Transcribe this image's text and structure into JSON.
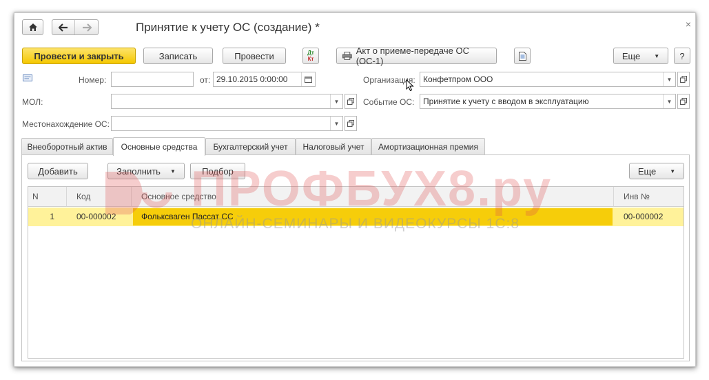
{
  "window": {
    "title": "Принятие к учету ОС (создание) *",
    "close": "×"
  },
  "toolbar": {
    "post_close": "Провести и закрыть",
    "save": "Записать",
    "post": "Провести",
    "dt_kt_top": "Дт",
    "dt_kt_bottom": "Кт",
    "print_act": "Акт о приеме-передаче ОС (ОС-1)",
    "more": "Еще",
    "help": "?"
  },
  "form": {
    "number_label": "Номер:",
    "number_value": "",
    "date_label": "от:",
    "date_value": "29.10.2015  0:00:00",
    "org_label": "Организация:",
    "org_value": "Конфетпром ООО",
    "mol_label": "МОЛ:",
    "mol_value": "",
    "event_label": "Событие ОС:",
    "event_value": "Принятие к учету с вводом в эксплуатацию",
    "location_label": "Местонахождение ОС:",
    "location_value": ""
  },
  "tabs": [
    {
      "label": "Внеоборотный актив"
    },
    {
      "label": "Основные средства"
    },
    {
      "label": "Бухгалтерский учет"
    },
    {
      "label": "Налоговый учет"
    },
    {
      "label": "Амортизационная премия"
    }
  ],
  "table_toolbar": {
    "add": "Добавить",
    "fill": "Заполнить",
    "select": "Подбор",
    "more": "Еще"
  },
  "table": {
    "headers": {
      "n": "N",
      "code": "Код",
      "asset": "Основное средство",
      "inv": "Инв №"
    },
    "rows": [
      {
        "n": "1",
        "code": "00-000002",
        "asset": "Фольксваген Пассат СС",
        "inv": "00-000002"
      }
    ]
  },
  "watermark": {
    "title": "ПРОФБУХ8.ру",
    "subtitle": "ОНЛАЙН-СЕМИНАРЫ И ВИДЕОКУРСЫ 1С:8"
  },
  "colors": {
    "accent_yellow": "#f5c800",
    "row_highlight": "#fff29a",
    "watermark_red": "#e05050"
  }
}
